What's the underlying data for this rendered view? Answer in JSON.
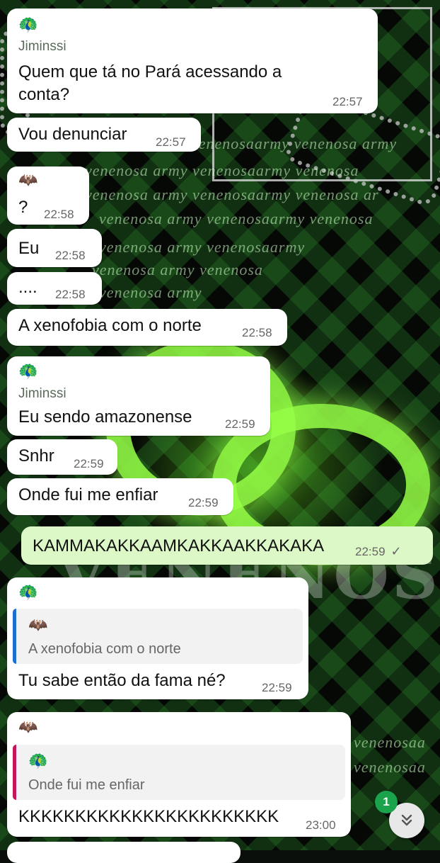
{
  "messages": [
    {
      "avatar": "🦚",
      "sender": "Jiminssi",
      "text_line1": "Quem que tá no Pará acessando a",
      "text_line2": "conta?",
      "time": "22:57"
    },
    {
      "text": "Vou denunciar",
      "time": "22:57"
    },
    {
      "avatar": "🦇",
      "text": "?",
      "time": "22:58"
    },
    {
      "text": "Eu",
      "time": "22:58"
    },
    {
      "text": "....",
      "time": "22:58"
    },
    {
      "text": "A xenofobia com o norte",
      "time": "22:58"
    },
    {
      "avatar": "🦚",
      "sender": "Jiminssi",
      "text": "Eu sendo amazonense",
      "time": "22:59"
    },
    {
      "text": "Snhr",
      "time": "22:59"
    },
    {
      "text": "Onde fui me enfiar",
      "time": "22:59"
    },
    {
      "text": "KAMMAKAKKAAMKAKKAAKKAKAKA",
      "time": "22:59",
      "status": "✓"
    },
    {
      "avatar": "🦚",
      "quote_icon": "🦇",
      "quote_text": "A xenofobia com o norte",
      "text": "Tu sabe então da fama né?",
      "time": "22:59"
    },
    {
      "avatar": "🦇",
      "quote_icon": "🦚",
      "quote_text": "Onde fui me enfiar",
      "text": "KKKKKKKKKKKKKKKKKKKKKKK",
      "time": "23:00"
    }
  ],
  "wallpaper": {
    "script_line1": "venenosaarmy    venenosa army",
    "script_line2": "venenosa army venenosaarmy    venenosa",
    "script_line3": "venenosa army venenosaarmy    venenosa ar",
    "script_line4": "venenosa army venenosaarmy    venenosa",
    "script_line5": "venenosa army venenosaarmy",
    "script_line6": "venenosa army venenosa",
    "script_line7": "venenosa army",
    "script_line8": "venenosaa",
    "script_line9": "venenosaa",
    "big_text": "VENENOSA"
  },
  "scroll": {
    "unread_count": "1",
    "icon": "chevron-double-down"
  },
  "colors": {
    "incoming": "#ffffff",
    "outgoing": "#dcf8c6",
    "badge": "#1aa34a",
    "quote_bar_blue": "#1f6fd1",
    "quote_bar_pink": "#c2185b"
  }
}
